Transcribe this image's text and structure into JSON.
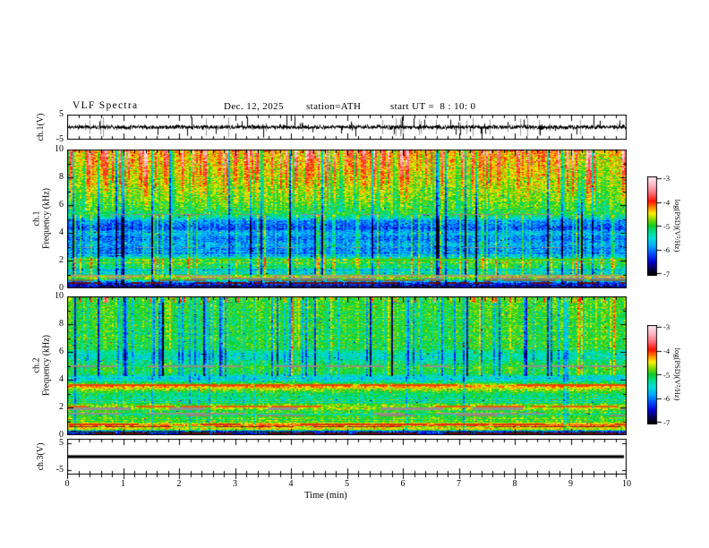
{
  "title": {
    "main": "VLF Spectra",
    "date": "Dec. 12, 2025",
    "station": "station=ATH",
    "start_ut": "start UT =  8 : 10: 0"
  },
  "axes": {
    "time_label": "Time  (min)",
    "time_ticks": [
      0,
      1,
      2,
      3,
      4,
      5,
      6,
      7,
      8,
      9,
      10
    ],
    "ch1v": {
      "label": "ch.1(V)",
      "ticks": [
        5,
        -5
      ]
    },
    "spec1": {
      "label_line1": "ch.1",
      "label_line2": "Frequency  (kHz)",
      "ticks": [
        10,
        8,
        6,
        4,
        2,
        0
      ]
    },
    "spec2": {
      "label_line1": "ch.2",
      "label_line2": "Frequency  (kHz)",
      "ticks": [
        10,
        8,
        6,
        4,
        2,
        0
      ]
    },
    "ch3v": {
      "label": "ch.3(V)",
      "ticks": [
        5,
        -5
      ]
    }
  },
  "colorbar": {
    "label": "log(PSD)(V²/Hz)",
    "ticks": [
      -3,
      -4,
      -5,
      -6,
      -7
    ],
    "stops": [
      [
        0.0,
        "#000000"
      ],
      [
        0.06,
        "#0a0055"
      ],
      [
        0.13,
        "#0000d4"
      ],
      [
        0.21,
        "#004eff"
      ],
      [
        0.29,
        "#00a8ff"
      ],
      [
        0.37,
        "#00e0d8"
      ],
      [
        0.44,
        "#00dd88"
      ],
      [
        0.5,
        "#11cc22"
      ],
      [
        0.565,
        "#88dd00"
      ],
      [
        0.625,
        "#ffee00"
      ],
      [
        0.675,
        "#ff9900"
      ],
      [
        0.75,
        "#ff1100"
      ],
      [
        0.83,
        "#ff6a75"
      ],
      [
        0.91,
        "#ffb3c0"
      ],
      [
        1.0,
        "#ffeef2"
      ]
    ]
  },
  "chart_data": {
    "type": "heatmap",
    "x_label": "Time (min)",
    "x_range": [
      0,
      10
    ],
    "panels": [
      {
        "id": "ch1_waveform",
        "type": "line",
        "ylabel": "ch.1(V)",
        "y_range": [
          -5,
          5
        ],
        "description": "broadband noise about 0 V with impulsive spikes to +/-5 V",
        "base_v": 1.0,
        "pad_v": 0.3,
        "spike_v": 4.8,
        "spike_prob": 0.09,
        "gray_prob": 0.05,
        "seed": 101
      },
      {
        "id": "ch1_spectrogram",
        "type": "heatmap",
        "ylabel": "ch.1 Frequency (kHz)",
        "y_range": [
          0,
          10
        ],
        "z_range": [
          -7,
          -3
        ],
        "z_label": "log(PSD)(V²/Hz)",
        "jitter": 0.35,
        "row_band_below": 2.6,
        "row_band_amp": 0.35,
        "col_amp": 0.18,
        "speckle": {
          "prob": 0.02,
          "amp": 1.3
        },
        "seed": 202,
        "profile": [
          [
            0,
            -7.0
          ],
          [
            0.12,
            -6.9
          ],
          [
            0.3,
            -6.7
          ],
          [
            0.45,
            -6.2
          ],
          [
            0.6,
            -5.2
          ],
          [
            0.8,
            -4.8
          ],
          [
            0.95,
            -5.1
          ],
          [
            1.2,
            -5.6
          ],
          [
            1.6,
            -5.35
          ],
          [
            1.9,
            -5.1
          ],
          [
            2.1,
            -4.85
          ],
          [
            2.35,
            -5.5
          ],
          [
            2.8,
            -6.0
          ],
          [
            3.2,
            -5.75
          ],
          [
            3.6,
            -6.05
          ],
          [
            4.0,
            -5.7
          ],
          [
            4.3,
            -6.15
          ],
          [
            4.9,
            -5.95
          ],
          [
            5.3,
            -5.15
          ],
          [
            6.0,
            -4.95
          ],
          [
            7.0,
            -4.8
          ],
          [
            8.0,
            -4.65
          ],
          [
            9.0,
            -4.5
          ],
          [
            10.0,
            -4.35
          ]
        ],
        "streaks": [
          {
            "prob": 0.38,
            "dmin": 0.35,
            "dmax": 1.35,
            "flo": 5.5,
            "fhi": 10,
            "fade": "top"
          },
          {
            "prob": 0.15,
            "dmin": -0.5,
            "dmax": -0.25,
            "flo": 5.5,
            "fhi": 10
          },
          {
            "prob": 0.07,
            "dmin": -1.4,
            "dmax": -0.7,
            "flo": 0.3,
            "fhi": 10
          },
          {
            "prob": 0.13,
            "dmin": 0.45,
            "dmax": 0.95,
            "flo": 1.0,
            "fhi": 5.3
          }
        ],
        "hlines": [
          {
            "f": 5.35,
            "color": "#8a8a8a",
            "th": 1,
            "dash": [
              8,
              30
            ],
            "gap": 0.4
          },
          {
            "f": 3.0,
            "color": "#8f8f8f",
            "th": 1,
            "dash": [
              6,
              24
            ],
            "gap": 0.5
          },
          {
            "f": 2.05,
            "color": "#55cc00",
            "th": 2,
            "dash": [
              20,
              60
            ],
            "gap": 0.35
          },
          {
            "f": 0.9,
            "color": "#a0a070",
            "th": 2,
            "dash": [
              15,
              50
            ],
            "gap": 0.3
          },
          {
            "f": 0.72,
            "color": "#8a8a8a",
            "th": 2,
            "dash": [
              15,
              45
            ],
            "gap": 0.35
          },
          {
            "f": 0.55,
            "color": "#73734a",
            "th": 2,
            "dash": [
              10,
              40
            ],
            "gap": 0.3
          },
          {
            "f": 0.38,
            "color": "#6a1010",
            "th": 2,
            "dash": [
              8,
              30
            ],
            "gap": 0.3
          },
          {
            "f": 0.18,
            "color": "#151515",
            "th": 1,
            "dash": [
              10,
              40
            ],
            "gap": 0.3
          }
        ]
      },
      {
        "id": "ch2_spectrogram",
        "type": "heatmap",
        "ylabel": "ch.2 Frequency (kHz)",
        "y_range": [
          0,
          10
        ],
        "z_range": [
          -7,
          -3
        ],
        "z_label": "log(PSD)(V²/Hz)",
        "jitter": 0.3,
        "row_band_below": 2.6,
        "row_band_amp": 0.3,
        "col_amp": 0.16,
        "speckle": {
          "prob": 0.03,
          "amp": 1.1
        },
        "seed": 303,
        "profile": [
          [
            0,
            -7.0
          ],
          [
            0.07,
            -6.8
          ],
          [
            0.15,
            -6.1
          ],
          [
            0.25,
            -6.6
          ],
          [
            0.4,
            -5.1
          ],
          [
            0.5,
            -4.55
          ],
          [
            0.62,
            -4.8
          ],
          [
            0.78,
            -4.15
          ],
          [
            0.92,
            -4.6
          ],
          [
            1.1,
            -4.8
          ],
          [
            1.3,
            -5.1
          ],
          [
            1.55,
            -5.2
          ],
          [
            1.75,
            -5.0
          ],
          [
            1.95,
            -4.6
          ],
          [
            2.2,
            -5.05
          ],
          [
            2.6,
            -5.3
          ],
          [
            3.0,
            -5.15
          ],
          [
            3.3,
            -4.75
          ],
          [
            3.58,
            -4.2
          ],
          [
            3.8,
            -5.05
          ],
          [
            4.1,
            -5.7
          ],
          [
            4.45,
            -5.15
          ],
          [
            4.8,
            -5.0
          ],
          [
            5.2,
            -5.1
          ],
          [
            5.6,
            -5.45
          ],
          [
            5.95,
            -5.4
          ],
          [
            6.3,
            -5.05
          ],
          [
            7.0,
            -5.0
          ],
          [
            8.0,
            -5.0
          ],
          [
            9.0,
            -4.95
          ],
          [
            10.0,
            -4.9
          ]
        ],
        "streaks": [
          {
            "prob": 0.17,
            "dmin": -1.0,
            "dmax": -0.45,
            "flo": 4.3,
            "fhi": 10
          },
          {
            "prob": 0.05,
            "dmin": -1.8,
            "dmax": -1.1,
            "flo": 4.3,
            "fhi": 10
          },
          {
            "prob": 0.06,
            "dmin": 0.3,
            "dmax": 0.7,
            "flo": 4.3,
            "fhi": 10
          },
          {
            "prob": 0.04,
            "dmin": -0.8,
            "dmax": -0.4,
            "flo": 0.3,
            "fhi": 10
          },
          {
            "prob": 0.07,
            "dmin": 0.6,
            "dmax": 1.4,
            "flo": 9.6,
            "fhi": 10
          }
        ],
        "hlines": [
          {
            "f": 5.0,
            "color": "#8f8f8f",
            "th": 2,
            "dash": [
              12,
              45
            ],
            "gap": 0.4
          },
          {
            "f": 3.62,
            "color": "#e84800",
            "th": 2,
            "dash": [
              30,
              90
            ],
            "gap": 0.12
          },
          {
            "f": 3.42,
            "color": "#cfc000",
            "th": 1,
            "dash": [
              15,
              50
            ],
            "gap": 0.45
          },
          {
            "f": 2.08,
            "color": "#e06010",
            "th": 2,
            "dash": [
              15,
              60
            ],
            "gap": 0.3
          },
          {
            "f": 1.93,
            "color": "#8f8f8f",
            "th": 3,
            "dash": [
              25,
              70
            ],
            "gap": 0.4
          },
          {
            "f": 1.55,
            "color": "#909090",
            "th": 2,
            "dash": [
              20,
              60
            ],
            "gap": 0.45
          },
          {
            "f": 1.42,
            "color": "#8d8d68",
            "th": 2,
            "dash": [
              20,
              60
            ],
            "gap": 0.5
          },
          {
            "f": 0.8,
            "color": "#d83808",
            "th": 2,
            "dash": [
              25,
              80
            ],
            "gap": 0.15
          },
          {
            "f": 0.66,
            "color": "#7c2010",
            "th": 1,
            "dash": [
              10,
              40
            ],
            "gap": 0.35
          },
          {
            "f": 0.28,
            "color": "#103a10",
            "th": 1,
            "dash": [
              8,
              30
            ],
            "gap": 0.45
          },
          {
            "f": 0.16,
            "color": "#5a0f28",
            "th": 2,
            "dash": [
              12,
              45
            ],
            "gap": 0.25
          }
        ]
      },
      {
        "id": "ch3_waveform",
        "type": "line",
        "ylabel": "ch.3(V)",
        "y_range": [
          -5,
          5
        ],
        "description": "constant 0 V (flat thick line)",
        "value": 0,
        "thickness": 3.2,
        "seed": 404
      }
    ]
  }
}
